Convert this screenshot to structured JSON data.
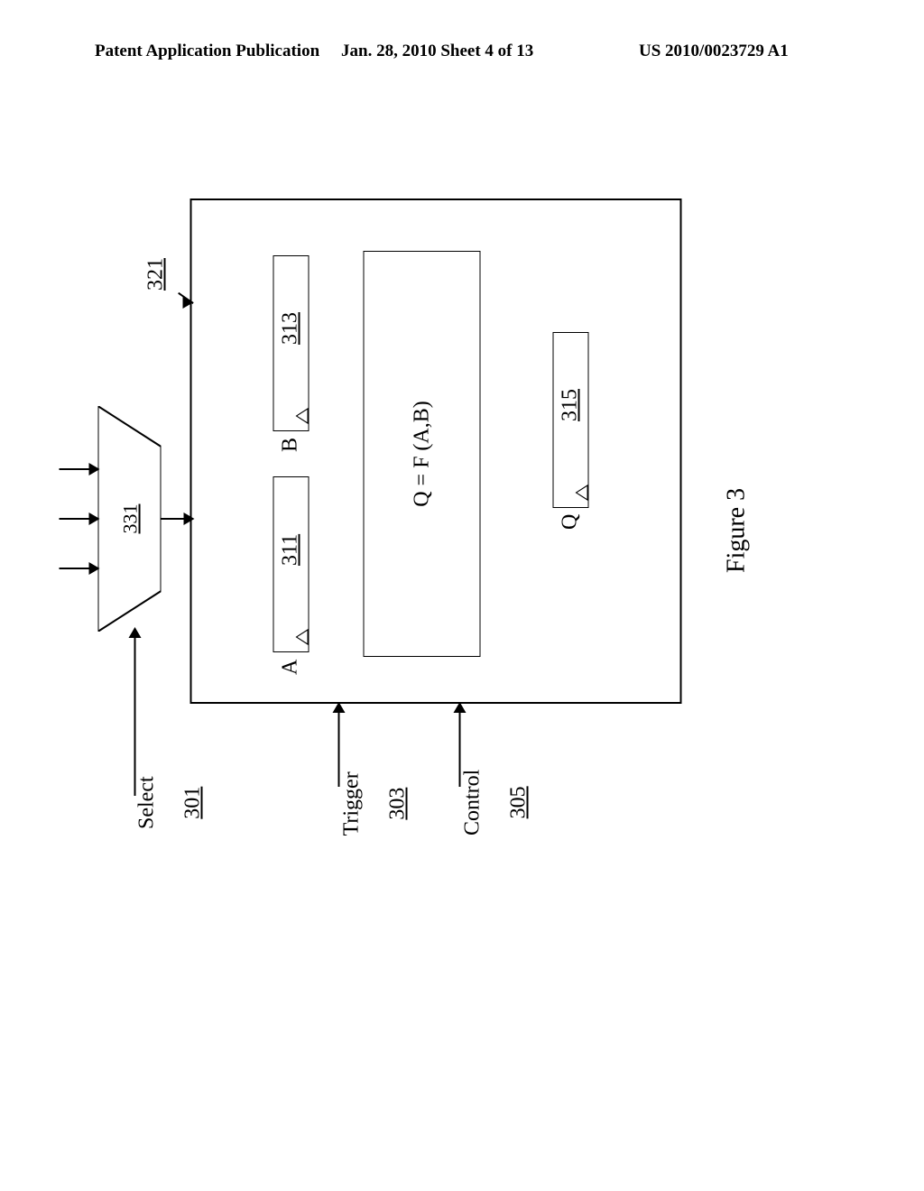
{
  "header": {
    "left": "Patent Application Publication",
    "mid": "Jan. 28, 2010   Sheet 4 of 13",
    "right": "US 2010/0023729 A1"
  },
  "diagram": {
    "signals": {
      "select": {
        "name": "Select",
        "ref": "301"
      },
      "trigger": {
        "name": "Trigger",
        "ref": "303"
      },
      "control": {
        "name": "Control",
        "ref": "305"
      }
    },
    "mux": {
      "ref": "331"
    },
    "block": {
      "ref": "321"
    },
    "regs": {
      "a": {
        "label": "A",
        "ref": "311"
      },
      "b": {
        "label": "B",
        "ref": "313"
      },
      "q": {
        "label": "Q",
        "ref": "315"
      }
    },
    "function_text": "Q = F (A,B)",
    "caption": "Figure 3"
  }
}
